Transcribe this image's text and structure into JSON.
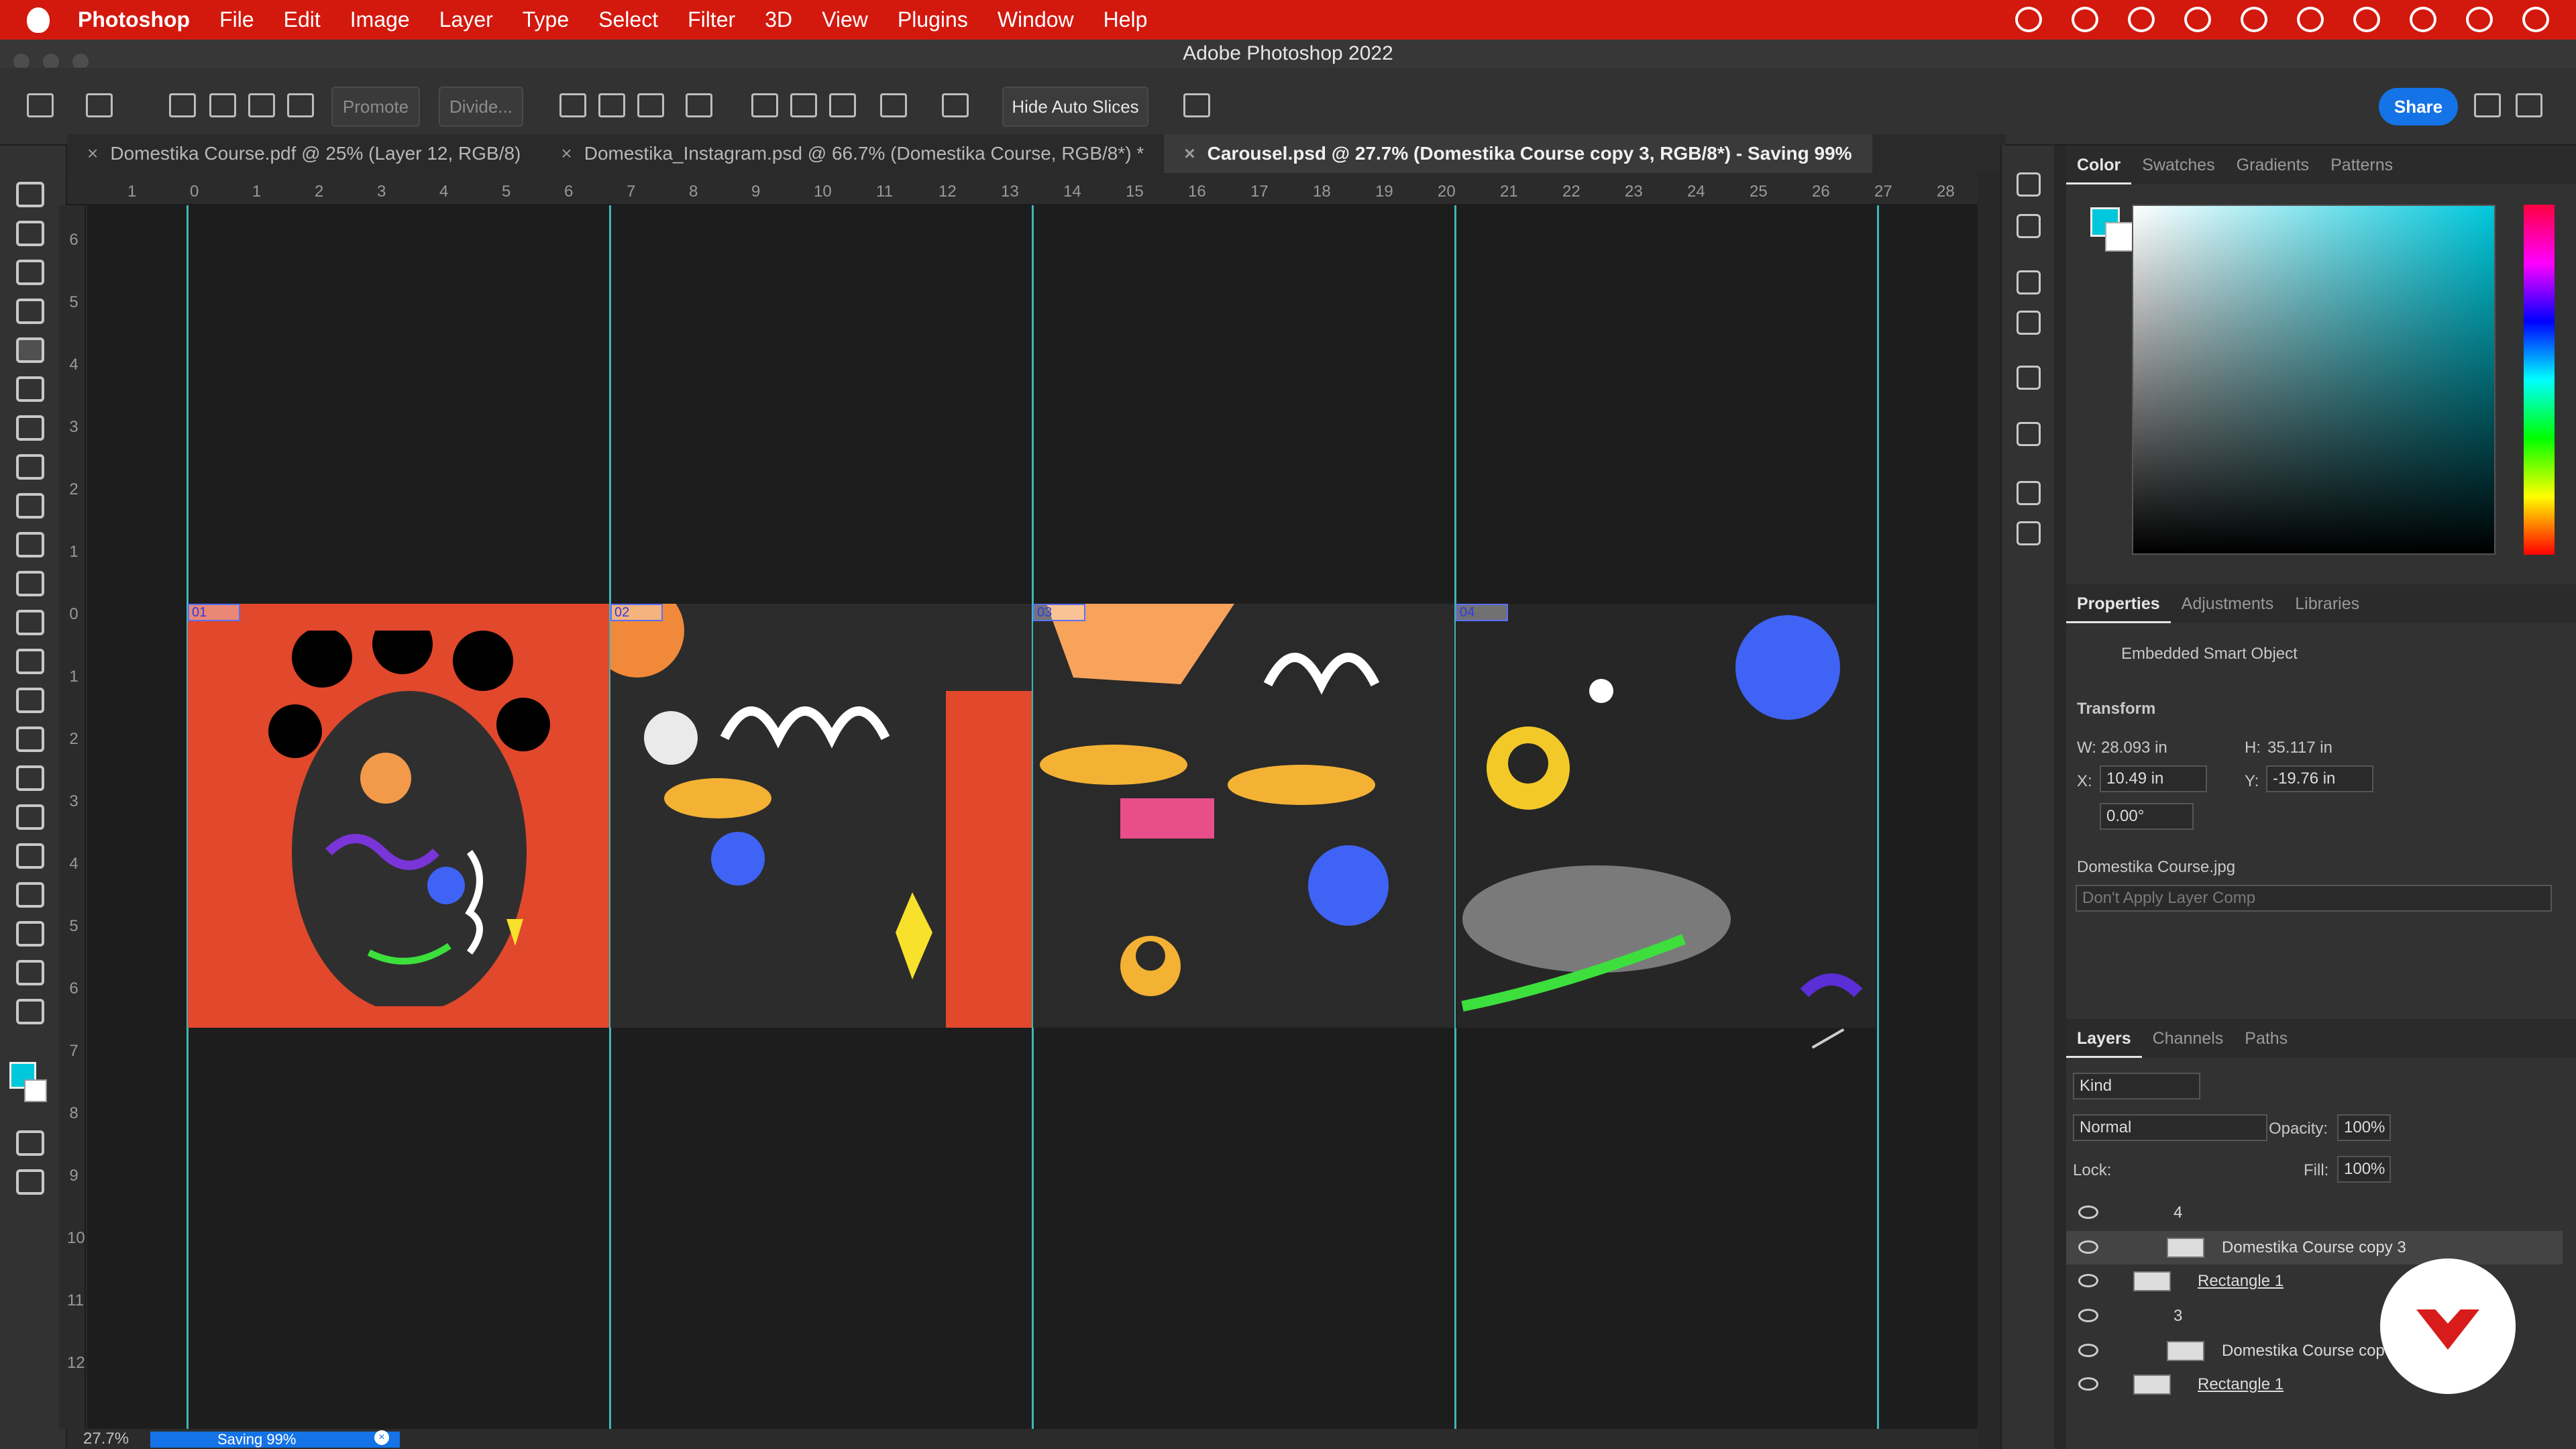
{
  "menubar": {
    "app": "Photoshop",
    "items": [
      "File",
      "Edit",
      "Image",
      "Layer",
      "Type",
      "Select",
      "Filter",
      "3D",
      "View",
      "Plugins",
      "Window",
      "Help"
    ]
  },
  "window": {
    "title": "Adobe Photoshop 2022"
  },
  "options": {
    "promote": "Promote",
    "divide": "Divide...",
    "hide_slices": "Hide Auto Slices",
    "share": "Share"
  },
  "tabs": [
    {
      "label": "Domestika Course.pdf @ 25% (Layer 12, RGB/8)",
      "active": false
    },
    {
      "label": "Domestika_Instagram.psd @ 66.7% (Domestika Course, RGB/8*) *",
      "active": false
    },
    {
      "label": "Carousel.psd @ 27.7% (Domestika Course copy 3, RGB/8*) - Saving 99%",
      "active": true
    }
  ],
  "ruler": {
    "h": [
      "1",
      "0",
      "1",
      "2",
      "3",
      "4",
      "5",
      "6",
      "7",
      "8",
      "9",
      "10",
      "11",
      "12",
      "13",
      "14",
      "15",
      "16",
      "17",
      "18",
      "19",
      "20",
      "21",
      "22",
      "23",
      "24",
      "25",
      "26",
      "27",
      "28"
    ],
    "v": [
      "6",
      "5",
      "4",
      "3",
      "2",
      "1",
      "0",
      "1",
      "2",
      "3",
      "4",
      "5",
      "6",
      "7",
      "8",
      "9",
      "10",
      "11",
      "12"
    ]
  },
  "slices": [
    "01",
    "02",
    "03",
    "04"
  ],
  "status": {
    "zoom": "27.7%",
    "progress": "Saving 99%",
    "progress_pct": 99
  },
  "color_panel": {
    "tabs": [
      "Color",
      "Swatches",
      "Gradients",
      "Patterns"
    ],
    "foreground": "#00c8dc",
    "background": "#ffffff"
  },
  "properties": {
    "tabs": [
      "Properties",
      "Adjustments",
      "Libraries"
    ],
    "type": "Embedded Smart Object",
    "section": "Transform",
    "w_label": "W:",
    "w": "28.093 in",
    "h_label": "H:",
    "h": "35.117 in",
    "x_label": "X:",
    "x": "10.49 in",
    "y_label": "Y:",
    "y": "-19.76 in",
    "angle": "0.00°",
    "file": "Domestika Course.jpg",
    "layer_comp": "Don't Apply Layer Comp"
  },
  "layers_panel": {
    "tabs": [
      "Layers",
      "Channels",
      "Paths"
    ],
    "filter": "Kind",
    "blend_mode": "Normal",
    "opacity_label": "Opacity:",
    "opacity": "100%",
    "lock_label": "Lock:",
    "fill_label": "Fill:",
    "fill": "100%",
    "layers": [
      {
        "name": "4",
        "kind": "group"
      },
      {
        "name": "Domestika Course copy 3",
        "kind": "smart",
        "selected": true
      },
      {
        "name": "Rectangle 1",
        "kind": "shape"
      },
      {
        "name": "3",
        "kind": "group"
      },
      {
        "name": "Domestika Course cop",
        "kind": "smart"
      },
      {
        "name": "Rectangle 1",
        "kind": "shape"
      }
    ]
  },
  "colors": {
    "accent": "#1473e6",
    "guide": "#40b6b5",
    "menubar": "#d3180e"
  }
}
